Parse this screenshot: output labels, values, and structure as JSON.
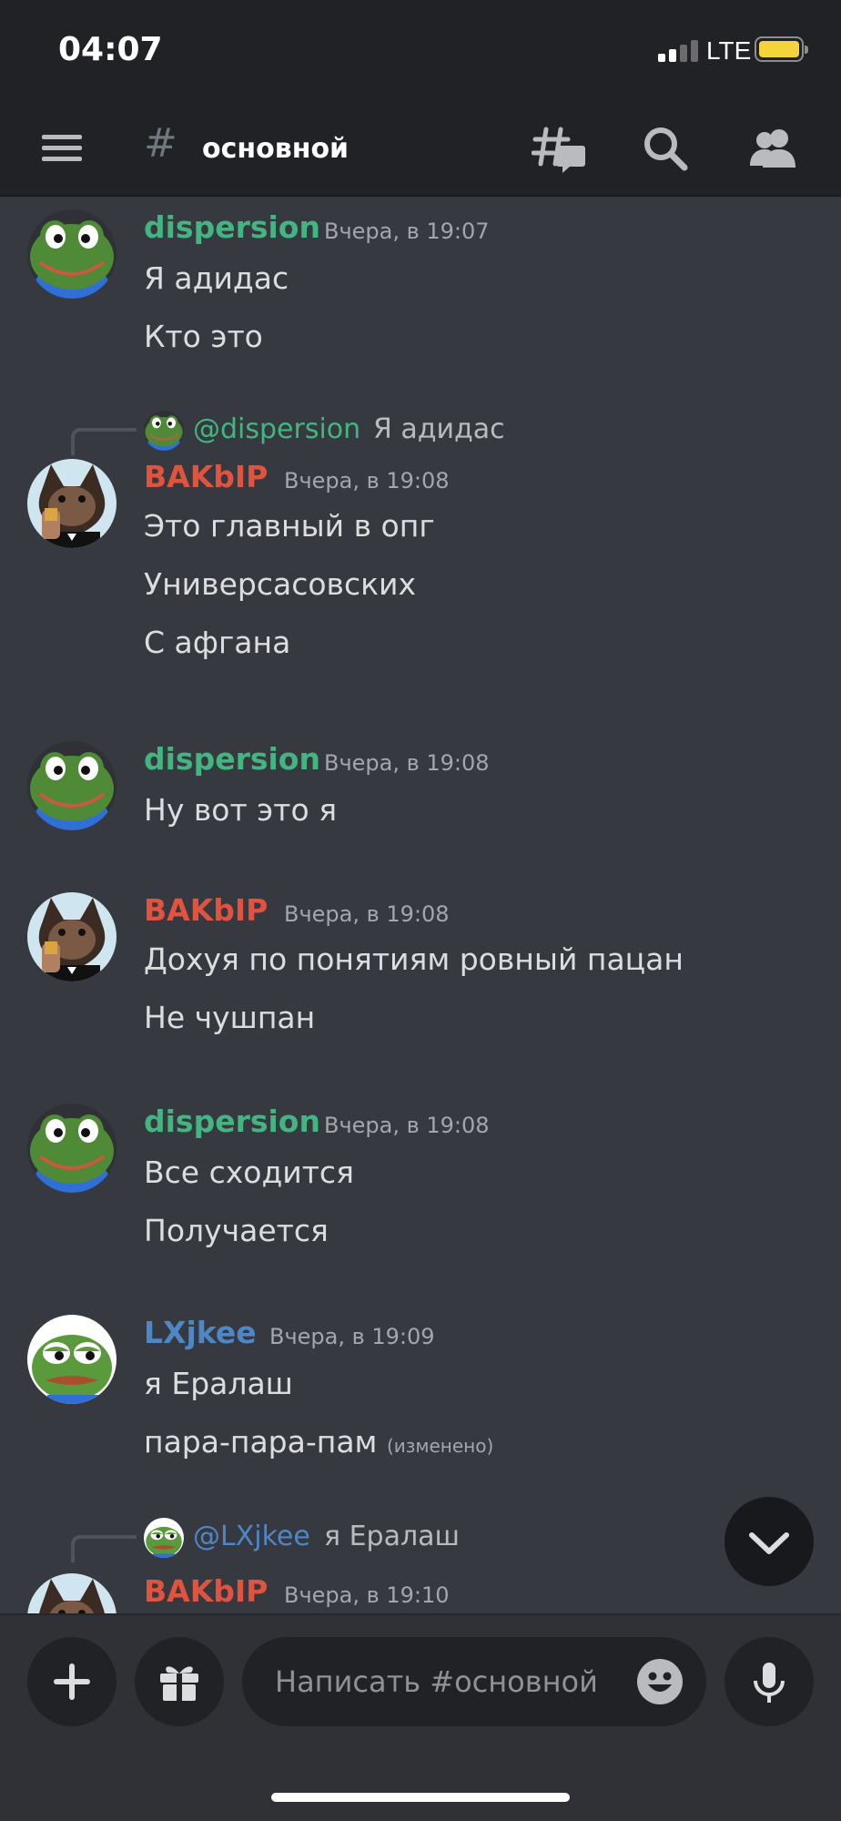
{
  "status_bar": {
    "time": "04:07",
    "network": "LTE"
  },
  "header": {
    "channel_hash": "#",
    "channel_name": "основной"
  },
  "messages": [
    {
      "author": "dispersion",
      "author_color": "#43b581",
      "timestamp": "Вчера, в 19:07",
      "avatar": "frog-avatar",
      "lines": [
        "Я адидас",
        "Кто это"
      ]
    },
    {
      "reply_to": {
        "name": "@dispersion",
        "text": "Я адидас",
        "name_color": "#43b581"
      },
      "author": "BAKbIP",
      "author_color": "#e0533f",
      "timestamp": "Вчера, в 19:08",
      "avatar": "cat-avatar",
      "lines": [
        "Это главный в опг",
        "Универсасовских",
        "С афгана"
      ]
    },
    {
      "author": "dispersion",
      "author_color": "#43b581",
      "timestamp": "Вчера, в 19:08",
      "avatar": "frog-avatar",
      "lines": [
        "Ну вот это я"
      ]
    },
    {
      "author": "BAKbIP",
      "author_color": "#e0533f",
      "timestamp": "Вчера, в 19:08",
      "avatar": "cat-avatar",
      "lines": [
        "Дохуя по понятиям ровный пацан",
        "Не чушпан"
      ]
    },
    {
      "author": "dispersion",
      "author_color": "#43b581",
      "timestamp": "Вчера, в 19:08",
      "avatar": "frog-avatar",
      "lines": [
        "Все сходится",
        "Получается"
      ]
    },
    {
      "author": "LXjkee",
      "author_color": "#4e87c5",
      "timestamp": "Вчера, в 19:09",
      "avatar": "pepe-avatar",
      "lines": [
        "я Ералаш",
        "пара-пара-пам"
      ],
      "edited": "(изменено)"
    },
    {
      "reply_to": {
        "name": "@LXjkee",
        "text": "я Ералаш",
        "name_color": "#4e87c5"
      },
      "author": "BAKbIP",
      "author_color": "#e0533f",
      "timestamp": "Вчера, в 19:10",
      "avatar": "cat-avatar",
      "lines": []
    }
  ],
  "composer": {
    "placeholder": "Написать #основной"
  }
}
